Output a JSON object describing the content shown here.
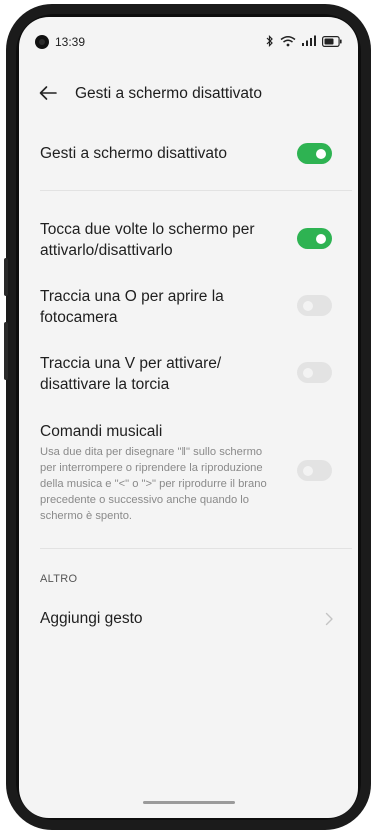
{
  "status": {
    "time": "13:39",
    "icons": [
      "bluetooth-icon",
      "wifi-icon",
      "signal-icon",
      "battery-icon"
    ]
  },
  "header": {
    "title": "Gesti a schermo disattivato",
    "back_icon": "arrow-left-icon"
  },
  "settings": [
    {
      "label": "Gesti a schermo disattivato",
      "enabled": true
    },
    {
      "label": "Tocca due volte lo schermo per attivarlo/disattivarlo",
      "enabled": true
    },
    {
      "label": "Traccia una O per aprire la fotocamera",
      "enabled": false
    },
    {
      "label": "Traccia una V per attivare/ disattivare la torcia",
      "enabled": false
    },
    {
      "label": "Comandi musicali",
      "description": "Usa due dita per disegnare \"‖\" sullo schermo per interrompere o riprendere la riproduzione della musica e \"<\" o \">\" per riprodurre il brano precedente o successivo anche quando lo schermo è spento.",
      "enabled": false
    }
  ],
  "section_other": {
    "title": "ALTRO",
    "item_label": "Aggiungi gesto"
  },
  "colors": {
    "toggle_on": "#2eb352",
    "toggle_off": "#e3e3e3",
    "screen_bg": "#f4f4f4"
  }
}
